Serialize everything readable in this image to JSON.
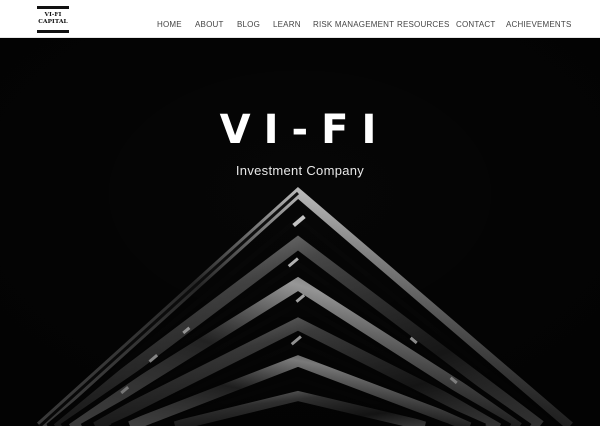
{
  "brand": {
    "logo_line1": "VI-FI",
    "logo_line2": "CAPITAL"
  },
  "nav": {
    "items": [
      {
        "label": "HOME"
      },
      {
        "label": "ABOUT"
      },
      {
        "label": "BLOG"
      },
      {
        "label": "LEARN"
      },
      {
        "label": "RISK MANAGEMENT"
      },
      {
        "label": "RESOURCES"
      },
      {
        "label": "CONTACT"
      },
      {
        "label": "ACHIEVEMENTS"
      }
    ]
  },
  "hero": {
    "title": "VI-FI",
    "subtitle": "Investment Company"
  },
  "colors": {
    "header_bg": "#ffffff",
    "hero_bg": "#050505",
    "nav_text": "#444444",
    "hero_text": "#ffffff"
  }
}
